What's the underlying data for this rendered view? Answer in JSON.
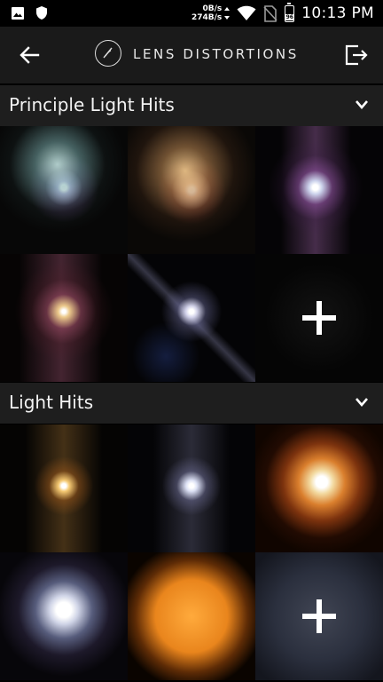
{
  "status_bar": {
    "net_down": "0B/s",
    "net_up": "274B/s",
    "battery": "96",
    "time": "10:13 PM"
  },
  "header": {
    "brand": "LENS DISTORTIONS",
    "back_icon": "arrow-left-icon",
    "exit_icon": "exit-icon"
  },
  "sections": [
    {
      "title": "Principle Light Hits",
      "chevron_icon": "chevron-down-icon"
    },
    {
      "title": "Light Hits",
      "chevron_icon": "chevron-down-icon"
    }
  ]
}
